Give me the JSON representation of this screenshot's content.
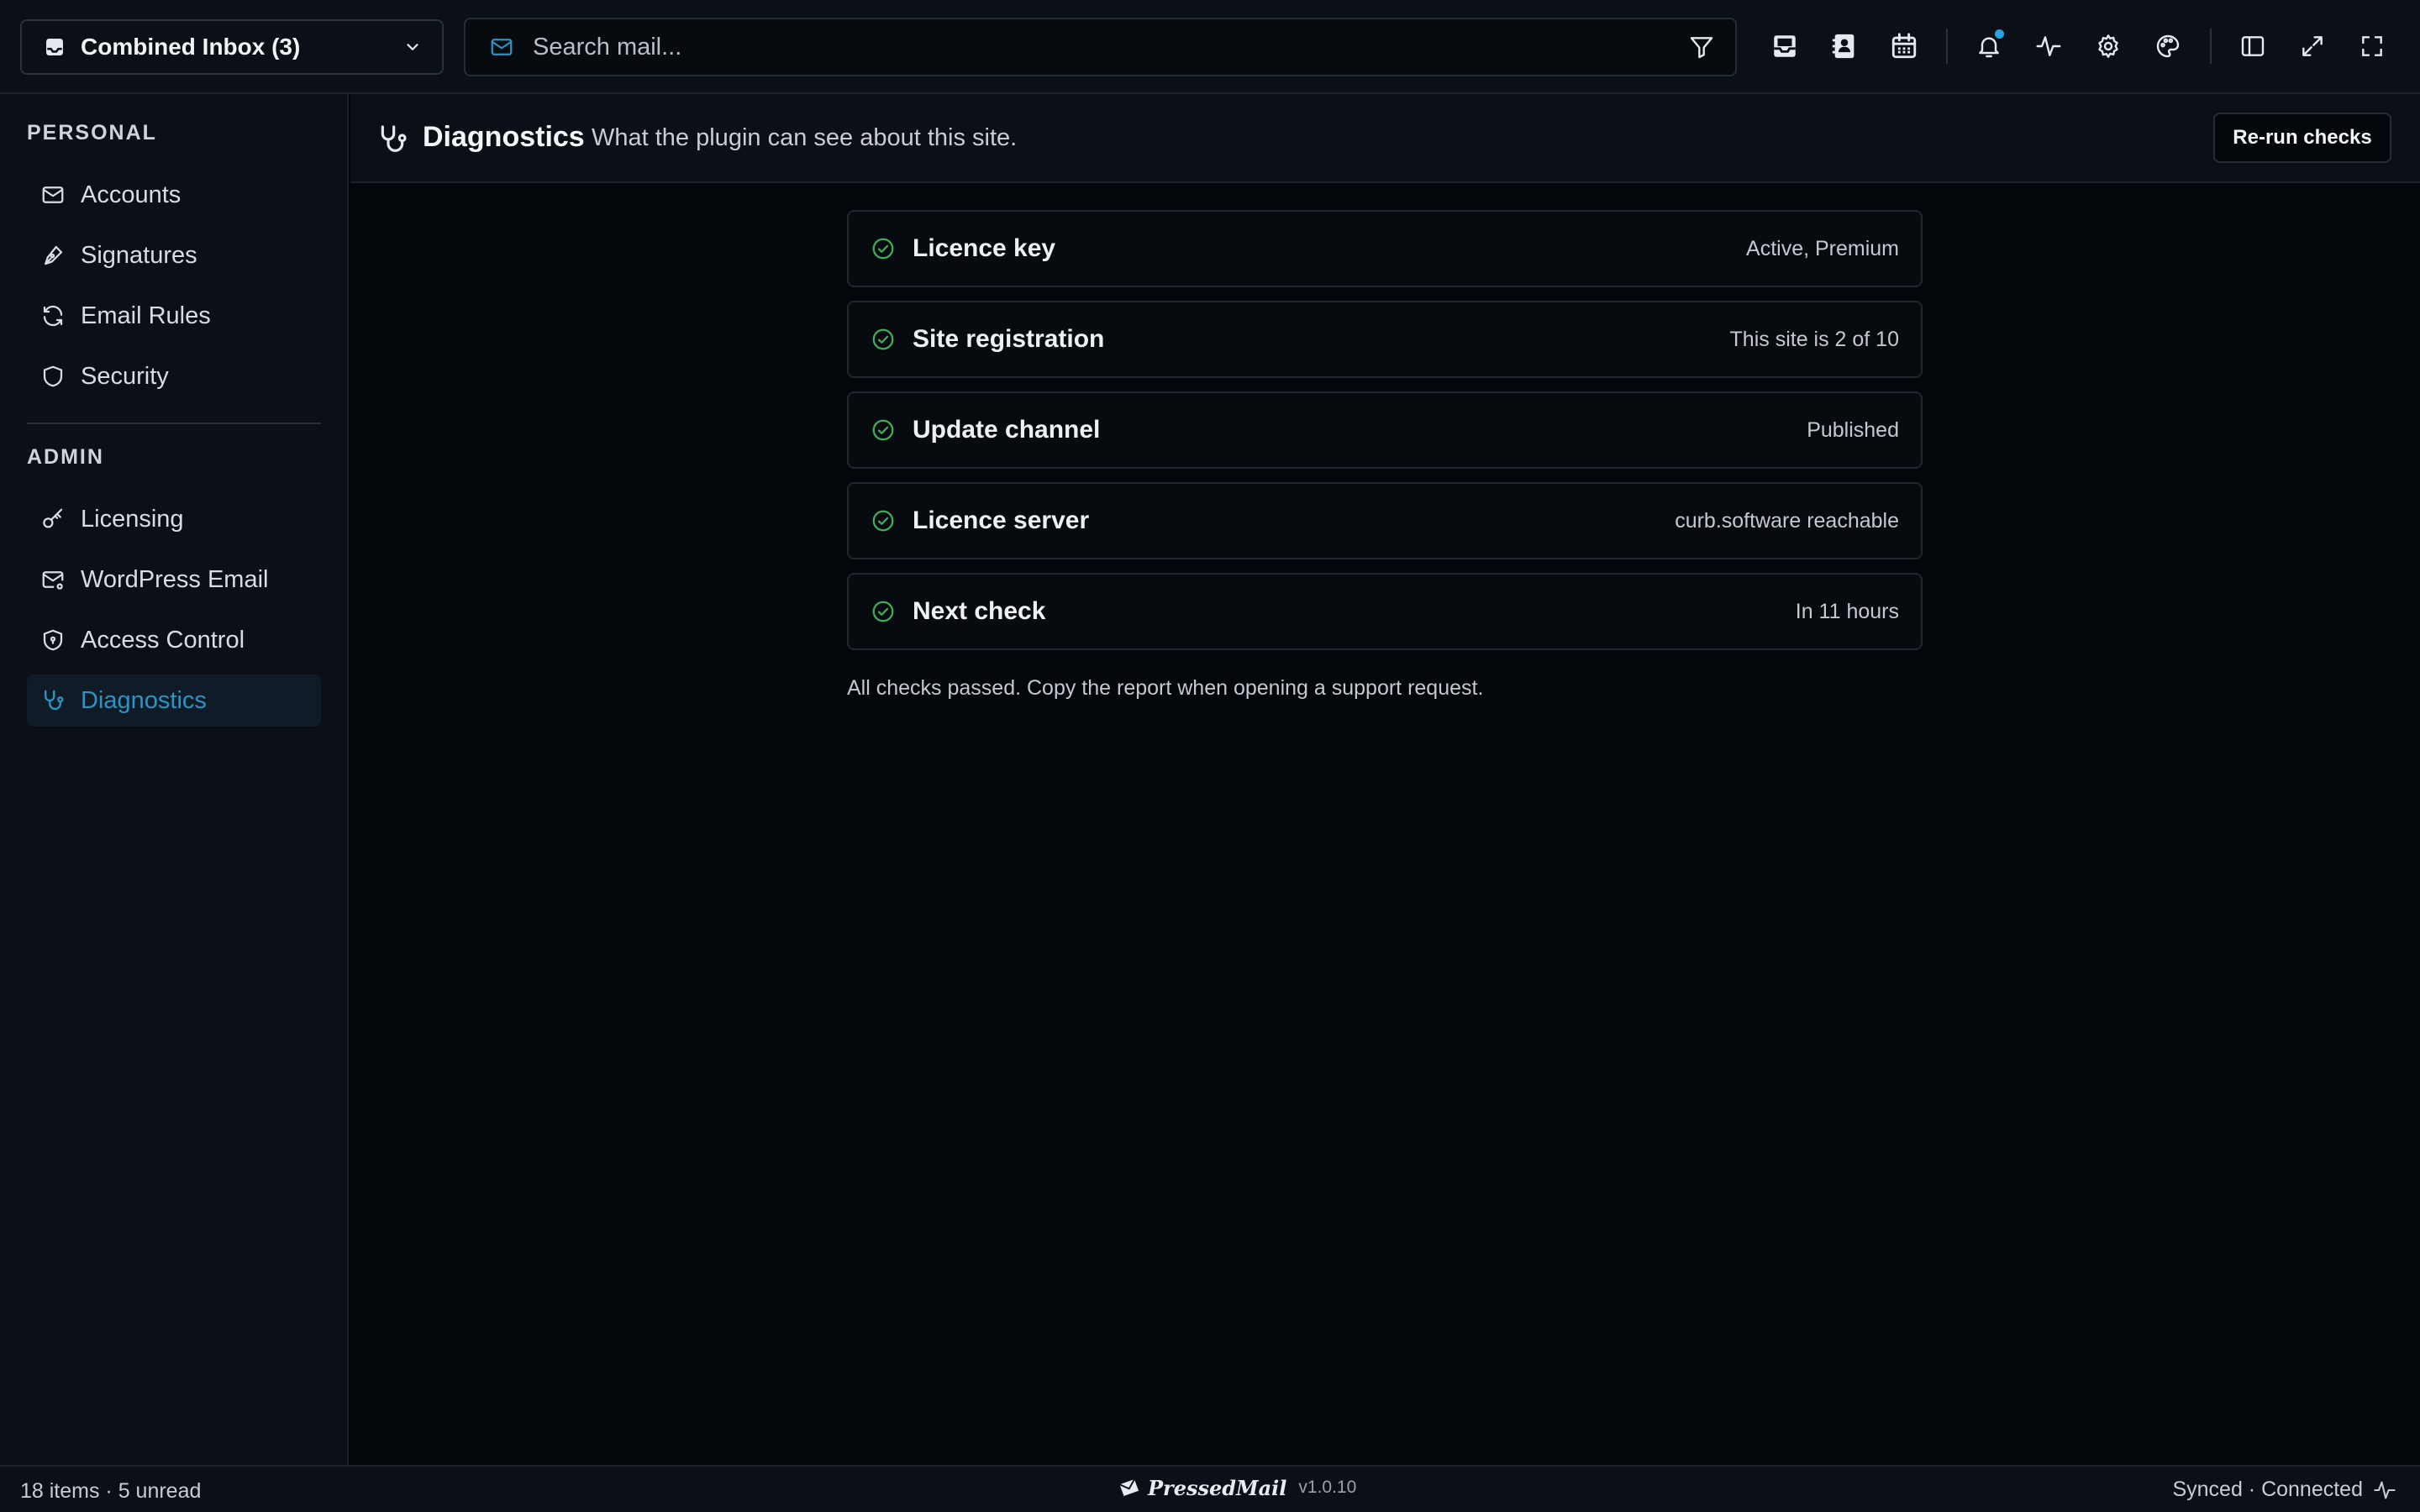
{
  "topbar": {
    "inbox_label": "Combined Inbox (3)",
    "search_placeholder": "Search mail..."
  },
  "sidebar": {
    "personal_title": "PERSONAL",
    "personal_items": [
      {
        "label": "Accounts",
        "icon": "mail-icon"
      },
      {
        "label": "Signatures",
        "icon": "pen-icon"
      },
      {
        "label": "Email Rules",
        "icon": "refresh-icon"
      },
      {
        "label": "Security",
        "icon": "shield-icon"
      }
    ],
    "admin_title": "ADMIN",
    "admin_items": [
      {
        "label": "Licensing",
        "icon": "key-icon"
      },
      {
        "label": "WordPress Email",
        "icon": "mail-settings-icon"
      },
      {
        "label": "Access Control",
        "icon": "shield-lock-icon"
      },
      {
        "label": "Diagnostics",
        "icon": "stethoscope-icon",
        "active": true
      }
    ]
  },
  "header": {
    "title": "Diagnostics",
    "subtitle": "What the plugin can see about this site.",
    "rerun_label": "Re-run checks"
  },
  "checks": [
    {
      "name": "Licence key",
      "value": "Active, Premium",
      "status": "ok"
    },
    {
      "name": "Site registration",
      "value": "This site is 2 of 10",
      "status": "ok"
    },
    {
      "name": "Update channel",
      "value": "Published",
      "status": "ok"
    },
    {
      "name": "Licence server",
      "value": "curb.software reachable",
      "status": "ok"
    },
    {
      "name": "Next check",
      "value": "In 11 hours",
      "status": "ok"
    }
  ],
  "note": "All checks passed. Copy the report when opening a support request.",
  "statusbar": {
    "items_summary": "18 items · 5 unread",
    "brand": "PressedMail",
    "version": "v1.0.10",
    "sync_status": "Synced · Connected"
  },
  "colors": {
    "accent": "#2c93c3",
    "ok": "#3fae5a",
    "notification_dot": "#26a3e0"
  }
}
